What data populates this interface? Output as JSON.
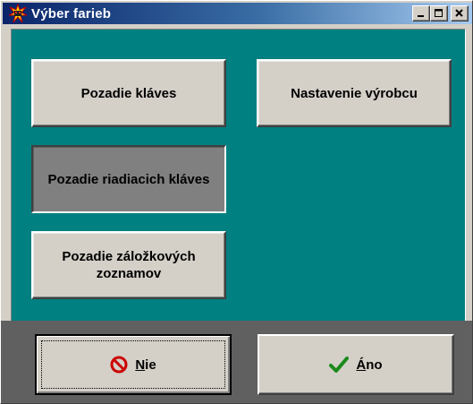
{
  "window": {
    "title": "Výber farieb",
    "controls": {
      "minimize_icon": "minimize-icon",
      "maximize_icon": "maximize-icon",
      "close_icon": "close-icon"
    }
  },
  "colors": {
    "content_background": "#008080",
    "title_gradient_start": "#0a246a",
    "title_gradient_end": "#a6caf0",
    "button_face": "#d4d0c8",
    "pressed_button_face": "#808080",
    "footer_background": "#606060",
    "no_icon_red": "#cc0000",
    "yes_icon_green": "#1a8a1a"
  },
  "options": [
    {
      "label": "Pozadie kláves",
      "state": "normal"
    },
    {
      "label": "Nastavenie výrobcu",
      "state": "normal"
    },
    {
      "label": "Pozadie riadiacich kláves",
      "state": "pressed"
    },
    {
      "label": "Pozadie záložkových zoznamov",
      "state": "normal"
    }
  ],
  "footer": {
    "no_button": {
      "mnemonic": "N",
      "rest": "ie",
      "icon": "no-entry-icon"
    },
    "yes_button": {
      "mnemonic": "Á",
      "rest": "no",
      "icon": "checkmark-icon"
    }
  }
}
